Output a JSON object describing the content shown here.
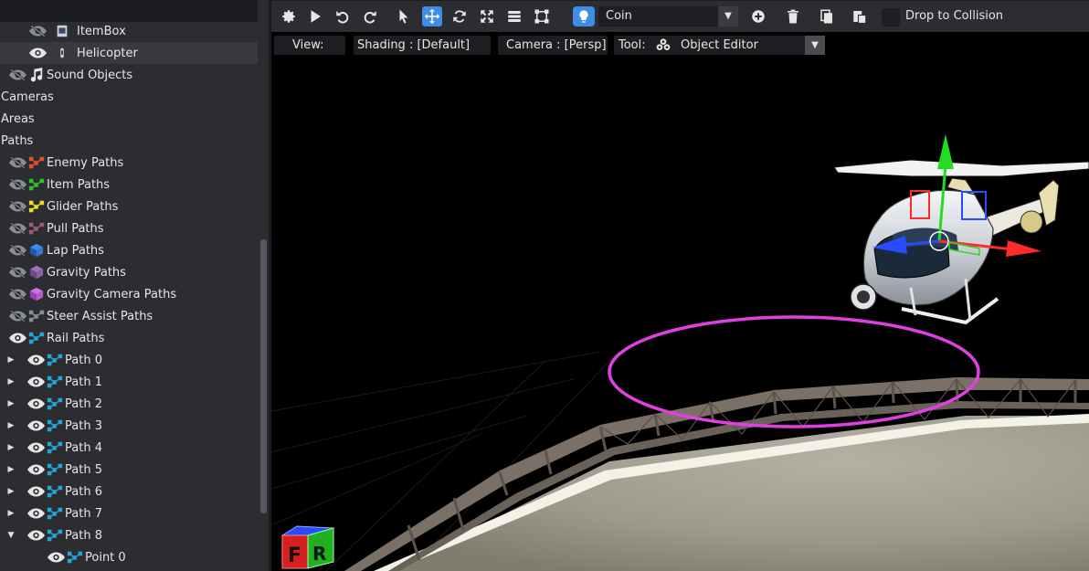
{
  "sidebar": {
    "items": [
      {
        "label": "ItemBox",
        "eye": "hidden",
        "icon": "itembox-icon",
        "arrow": "",
        "selected": false
      },
      {
        "label": "Helicopter",
        "eye": "visible",
        "icon": "helicopter-icon",
        "arrow": "",
        "selected": true
      },
      {
        "label": "Sound Objects",
        "eye": "hidden",
        "icon": "music-note-icon",
        "arrow": "",
        "selected": false
      },
      {
        "label": "Cameras",
        "eye": "",
        "icon": "",
        "arrow": "",
        "selected": false
      },
      {
        "label": "Areas",
        "eye": "",
        "icon": "",
        "arrow": "",
        "selected": false
      },
      {
        "label": "Paths",
        "eye": "",
        "icon": "",
        "arrow": "",
        "selected": false
      },
      {
        "label": "Enemy Paths",
        "eye": "hidden",
        "icon": "enemy-path-icon",
        "arrow": "",
        "selected": false
      },
      {
        "label": "Item Paths",
        "eye": "hidden",
        "icon": "item-path-icon",
        "arrow": "",
        "selected": false
      },
      {
        "label": "Glider Paths",
        "eye": "hidden",
        "icon": "glider-path-icon",
        "arrow": "",
        "selected": false
      },
      {
        "label": "Pull Paths",
        "eye": "hidden",
        "icon": "pull-path-icon",
        "arrow": "",
        "selected": false
      },
      {
        "label": "Lap Paths",
        "eye": "hidden",
        "icon": "lap-cube-icon",
        "arrow": "",
        "selected": false
      },
      {
        "label": "Gravity Paths",
        "eye": "hidden",
        "icon": "gravity-cube-icon",
        "arrow": "",
        "selected": false
      },
      {
        "label": "Gravity Camera Paths",
        "eye": "hidden",
        "icon": "gravity-camera-cube-icon",
        "arrow": "",
        "selected": false
      },
      {
        "label": "Steer Assist Paths",
        "eye": "hidden",
        "icon": "steer-assist-path-icon",
        "arrow": "",
        "selected": false
      },
      {
        "label": "Rail Paths",
        "eye": "visible",
        "icon": "rail-path-icon",
        "arrow": "",
        "selected": false
      },
      {
        "label": "Path 0",
        "eye": "visible",
        "icon": "rail-path-icon",
        "arrow": "▶",
        "selected": false
      },
      {
        "label": "Path 1",
        "eye": "visible",
        "icon": "rail-path-icon",
        "arrow": "▶",
        "selected": false
      },
      {
        "label": "Path 2",
        "eye": "visible",
        "icon": "rail-path-icon",
        "arrow": "▶",
        "selected": false
      },
      {
        "label": "Path 3",
        "eye": "visible",
        "icon": "rail-path-icon",
        "arrow": "▶",
        "selected": false
      },
      {
        "label": "Path 4",
        "eye": "visible",
        "icon": "rail-path-icon",
        "arrow": "▶",
        "selected": false
      },
      {
        "label": "Path 5",
        "eye": "visible",
        "icon": "rail-path-icon",
        "arrow": "▶",
        "selected": false
      },
      {
        "label": "Path 6",
        "eye": "visible",
        "icon": "rail-path-icon",
        "arrow": "▶",
        "selected": false
      },
      {
        "label": "Path 7",
        "eye": "visible",
        "icon": "rail-path-icon",
        "arrow": "▶",
        "selected": false
      },
      {
        "label": "Path 8",
        "eye": "visible",
        "icon": "rail-path-icon",
        "arrow": "▼",
        "selected": false
      },
      {
        "label": "Point 0",
        "eye": "visible",
        "icon": "rail-path-icon",
        "arrow": "",
        "selected": false
      }
    ]
  },
  "toolbar": {
    "object_select_value": "Coin",
    "drop_to_collision_label": "Drop to Collision",
    "buttons": [
      "settings-icon",
      "play-icon",
      "undo-icon",
      "redo-icon",
      "select-cursor-icon",
      "move-icon",
      "rotate-icon",
      "scale-icon",
      "snap-icon",
      "bounds-icon",
      "add-icon",
      "delete-icon",
      "copy-icon",
      "paste-icon"
    ]
  },
  "viewport_bar": {
    "view_label": "View:",
    "shading_label": "Shading : [Default]",
    "camera_label": "Camera : [Persp]",
    "tool_label": "Tool:",
    "tool_value": "Object Editor"
  },
  "orientation_cube": {
    "left_letter": "F",
    "right_letter": "R"
  },
  "colors": {
    "accent": "#3f8de6",
    "selection_ring": "#e040e0",
    "gizmo_x": "#ff2a2a",
    "gizmo_y": "#22dd22",
    "gizmo_z": "#2a4aff",
    "rail_path": "#22a6d6"
  }
}
